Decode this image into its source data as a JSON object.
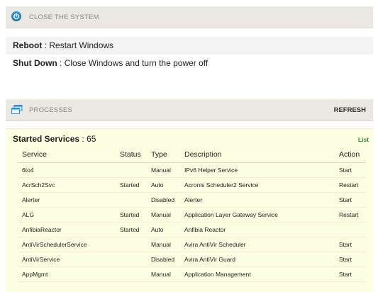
{
  "close_system": {
    "title": "CLOSE THE SYSTEM",
    "icon": "power-icon",
    "reboot": {
      "label": "Reboot",
      "sep": ":",
      "desc": "Restart Windows"
    },
    "shutdown": {
      "label": "Shut Down",
      "sep": ":",
      "desc": "Close Windows and turn the power off"
    }
  },
  "processes": {
    "title": "PROCESSES",
    "icon": "window-icon",
    "refresh_label": "REFRESH"
  },
  "services": {
    "title": "Started Services",
    "count_text": " : 65",
    "list_label": "List",
    "columns": [
      "Service",
      "Status",
      "Type",
      "Description",
      "Action"
    ],
    "rows": [
      [
        "6to4",
        "",
        "Manual",
        "IPv6 Helper Service",
        "Start"
      ],
      [
        "AcrSch2Svc",
        "Started",
        "Auto",
        "Acronis Scheduler2 Service",
        "Restart"
      ],
      [
        "Alerter",
        "",
        "Disabled",
        "Alerter",
        "Start"
      ],
      [
        "ALG",
        "Started",
        "Manual",
        "Application Layer Gateway Service",
        "Restart"
      ],
      [
        "AnfibiaReactor",
        "Started",
        "Auto",
        "Anfibia Reactor",
        ""
      ],
      [
        "AntiVirSchedulerService",
        "",
        "Manual",
        "Avira AntiVir Scheduler",
        "Start"
      ],
      [
        "AntiVirService",
        "",
        "Disabled",
        "Avira AntiVir Guard",
        "Start"
      ],
      [
        "AppMgmt",
        "",
        "Manual",
        "Application Management",
        "Start"
      ]
    ]
  },
  "colors": {
    "header_bg": "#ebe7e2",
    "services_bg": "#fefee3",
    "accent_blue": "#2d8fd6",
    "list_green": "#2e8b2e"
  }
}
